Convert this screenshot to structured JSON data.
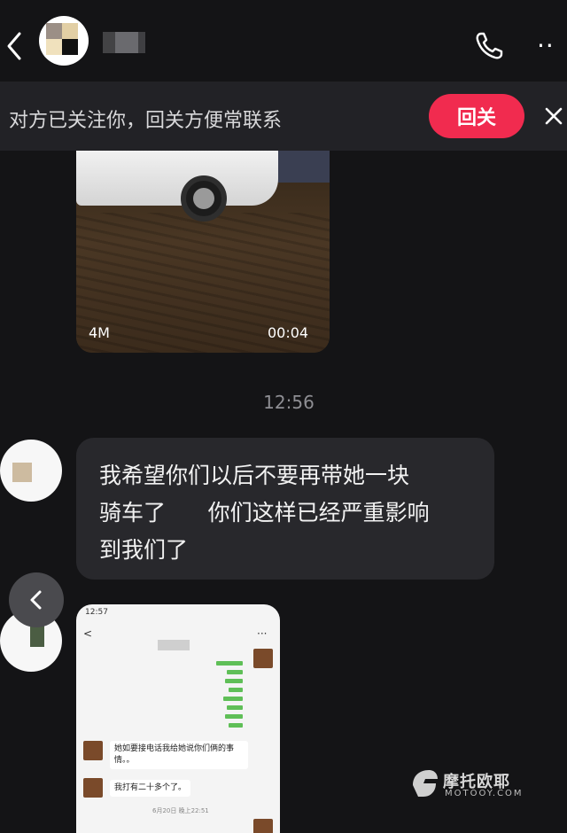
{
  "header": {
    "title": "",
    "back_icon": "chevron-left-icon",
    "phone_icon": "phone-icon",
    "more_label": "··"
  },
  "banner": {
    "text": "对方已关注你，回关方便常联系",
    "follow_button": "回关",
    "close_icon": "close-icon"
  },
  "video_message": {
    "size": "4M",
    "duration": "00:04"
  },
  "timestamp": "12:56",
  "text_message": {
    "lines": [
      "我希望你们以后不要再带她一块",
      "骑车了      你们这样已经严重影响",
      "到我们了"
    ]
  },
  "screenshot_message": {
    "status_time": "12:57",
    "back_label": "<",
    "more_label": "···",
    "msg1": "她如要接电话我给她说你们俩的事情。。",
    "msg2": "我打有二十多个了。",
    "date": "6月20日 晚上22:51"
  },
  "watermark": {
    "title": "摩托欧耶",
    "subtitle": "MOTOOY.COM"
  },
  "colors": {
    "background": "#141416",
    "banner": "#222226",
    "accent": "#f12b4f",
    "bubble": "#28282c"
  }
}
